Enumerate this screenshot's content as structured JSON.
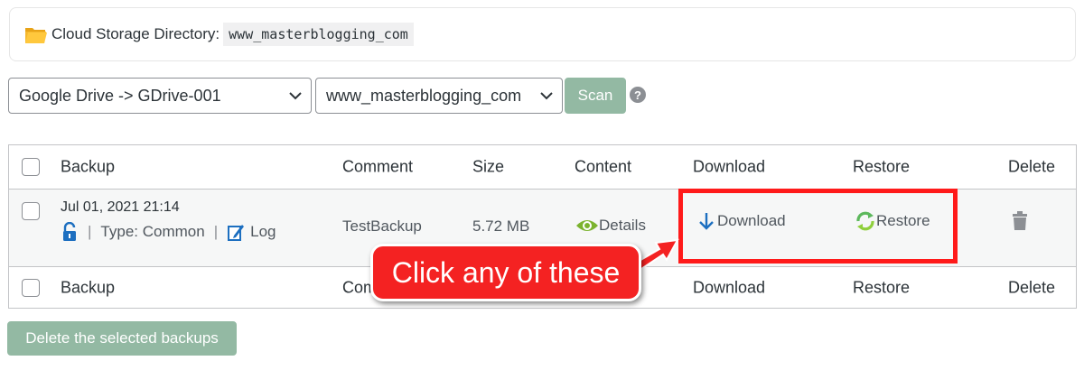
{
  "directory": {
    "label": "Cloud Storage Directory:",
    "value": "www_masterblogging_com"
  },
  "toolbar": {
    "storage_select": "Google Drive -> GDrive-001",
    "folder_select": "www_masterblogging_com",
    "scan_label": "Scan",
    "help_glyph": "?"
  },
  "table": {
    "headers": {
      "backup": "Backup",
      "comment": "Comment",
      "size": "Size",
      "content": "Content",
      "download": "Download",
      "restore": "Restore",
      "delete": "Delete"
    },
    "rows": [
      {
        "date": "Jul 01, 2021 21:14",
        "type": "Type: Common",
        "log": "Log",
        "separator": "|",
        "comment": "TestBackup",
        "size": "5.72 MB",
        "details": "Details",
        "download": "Download",
        "restore": "Restore"
      }
    ],
    "footer": {
      "backup": "Backup",
      "comment": "Comment",
      "download": "Download",
      "restore": "Restore",
      "delete": "Delete"
    }
  },
  "annotation": {
    "callout_text": "Click any of these",
    "color": "#f42222"
  },
  "actions": {
    "delete_selected_label": "Delete the selected backups"
  },
  "colors": {
    "button_green": "#93b9a3",
    "link_blue": "#1d6fc0",
    "eye_green": "#7bb32e",
    "restore_green": "#5cb85c"
  },
  "icons": [
    "folder-icon",
    "chevron-down-icon",
    "help-icon",
    "lock-icon",
    "log-icon",
    "eye-icon",
    "download-arrow-icon",
    "restore-icon",
    "trash-icon"
  ]
}
